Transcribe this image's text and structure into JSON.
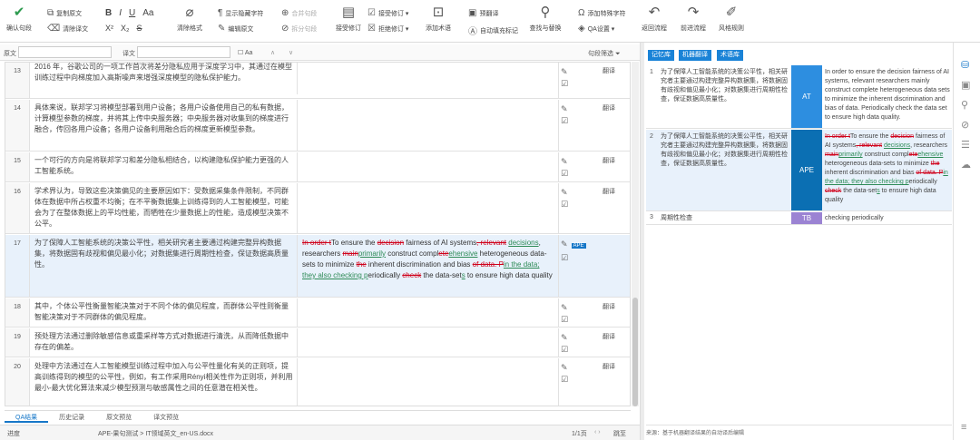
{
  "toolbar": {
    "confirm": "确认句段",
    "copy_src": "复制原文",
    "clear_tgt": "清除译文",
    "bold": "B",
    "italic": "I",
    "underline": "U",
    "fontsize": "Aa",
    "super": "X²",
    "sub": "X₂",
    "strike": "S",
    "clear_fmt": "清除格式",
    "show_hide": "显示隐藏字符",
    "edit_src": "编辑原文",
    "merge": "合并句段",
    "split": "拆分句段",
    "accept": "接受修订",
    "reject": "拒绝修订",
    "receive": "接受修订 ▾",
    "refuse": "拒绝修订 ▾",
    "add_term": "添加术语",
    "translate": "预翻译",
    "auto": "自动填充标记",
    "find": "查找与替换",
    "special": "添加特殊字符",
    "qa": "QA设置 ▾",
    "back": "返回流程",
    "forward": "前进流程",
    "style": "风格规则"
  },
  "filter": {
    "src_label": "原文",
    "tgt_label": "译文",
    "case": "Aa",
    "status": "句段筛选"
  },
  "rows": [
    {
      "num": "13",
      "src": "2016 年，谷歌公司的一项工作首次将差分隐私应用于深度学习中，其通过在模型训练过程中向梯度加入高斯噪声来增强深度模型的隐私保护能力。",
      "status": "翻译"
    },
    {
      "num": "14",
      "src": "具体来说，联邦学习将模型部署到用户设备；各用户设备使用自己的私有数据，计算模型参数的梯度，并将其上传中央服务器；中央服务器对收集到的梯度进行融合，传回各用户设备；各用户设备利用融合后的梯度更新模型参数。",
      "status": "翻译"
    },
    {
      "num": "15",
      "src": "一个可行的方向是将联邦学习和差分隐私相结合，以构建隐私保护能力更强的人工智能系统。",
      "status": "翻译"
    },
    {
      "num": "16",
      "src": "学术界认为，导致这些决策偏见的主要原因如下：受数据采集条件限制，不同群体在数据中所占权重不均衡；在不平衡数据集上训练得到的人工智能模型，可能会为了在整体数据上的平均性能，而牺牲在少量数据上的性能，造成模型决策不公平。",
      "status": "翻译"
    },
    {
      "num": "17",
      "src": "为了保障人工智能系统的决策公平性，相关研究者主要通过构建完整异构数据集，将数据固有歧视和偏见最小化；对数据集进行周期性检查，保证数据高质量性。",
      "status": "APE"
    },
    {
      "num": "18",
      "src": "其中，个体公平性衡量智能决策对于不同个体的偏见程度，而群体公平性则衡量智能决策对于不同群体的偏见程度。",
      "status": "翻译"
    },
    {
      "num": "19",
      "src": "预处理方法通过删除敏感信息或重采样等方式对数据进行清洗，从而降低数据中存在的偏差。",
      "status": "翻译"
    },
    {
      "num": "20",
      "src": "处理中方法通过在人工智能模型训练过程中加入与公平性量化有关的正则项，提高训练得到的模型的公平性，例如，有工作采用Rényi相关性作为正则项，并利用最小-最大优化算法来减少模型预测与敏感属性之间的任意潜在相关性。",
      "status": "翻译"
    }
  ],
  "bottom_tabs": [
    "QA结果",
    "历史记录",
    "原文预览",
    "译文预览"
  ],
  "statusbar": {
    "left": "进度",
    "file": "APE-果句测试 > IT领域英文_en-US.docx",
    "page": "1/1页",
    "jump": "跳至"
  },
  "right": {
    "tabs": [
      "记忆库",
      "机器翻译",
      "术语库"
    ],
    "m1_src": "为了保障人工智能系统的决策公平性，相关研究者主要通过构建完整异构数据集，将数据固有歧视和偏见最小化；对数据集进行周期性检查，保证数据高质量性。",
    "m1_tag": "AT",
    "m1_tgt": "In order to ensure the decision fairness of AI systems, relevant researchers mainly construct complete heterogeneous data sets to minimize the inherent discrimination and bias of data. Periodically check the data set to ensure high data quality.",
    "m2_tag": "APE",
    "m3_src": "周期性检查",
    "m3_tag": "TB",
    "m3_tgt": "checking periodically",
    "footer": "来源：基于机器翻译结果的自动译后编辑",
    "num1": "1",
    "num2": "2",
    "num3": "3"
  },
  "colors": {
    "accent": "#1677c8",
    "ape": "#0b6fb3",
    "at": "#2d8ee0",
    "tb": "#9b83d3"
  }
}
